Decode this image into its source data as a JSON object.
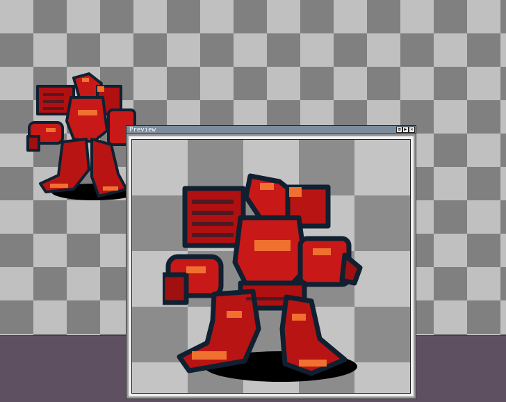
{
  "app": {
    "colors": {
      "desktop": "#5e5060",
      "checker_light": "#c0c0c0",
      "checker_dark": "#808080",
      "titlebar": "#7c8c9c",
      "robot_red": "#c81818",
      "robot_orange": "#f07030",
      "robot_outline": "#102030"
    }
  },
  "canvas": {
    "sprite_name": "red-mech-robot-sprite"
  },
  "preview_window": {
    "title": "Preview",
    "buttons": [
      {
        "icon": "zoom-icon",
        "glyph": "⊞"
      },
      {
        "icon": "play-icon",
        "glyph": "▶"
      },
      {
        "icon": "close-icon",
        "glyph": "✕"
      }
    ]
  }
}
